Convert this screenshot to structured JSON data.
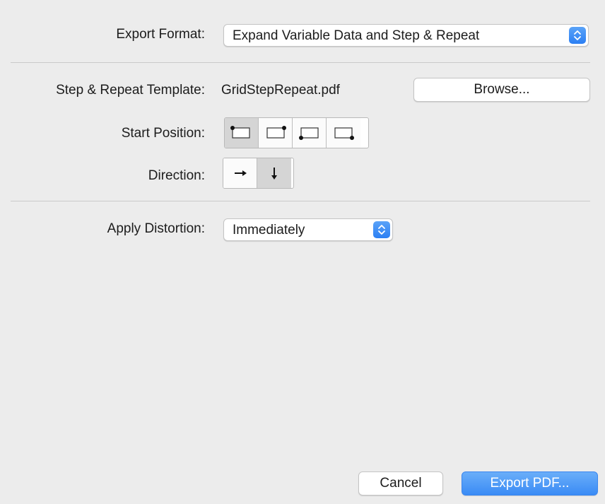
{
  "export_format": {
    "label": "Export Format:",
    "selected": "Expand Variable Data and Step & Repeat"
  },
  "template": {
    "label": "Step & Repeat Template:",
    "filename": "GridStepRepeat.pdf",
    "browse_label": "Browse..."
  },
  "start_position": {
    "label": "Start Position:",
    "options": [
      "top-left",
      "top-right",
      "bottom-left",
      "bottom-right"
    ],
    "selected": "top-left"
  },
  "direction": {
    "label": "Direction:",
    "options": [
      "horizontal",
      "vertical"
    ],
    "icons": [
      "arrow-right-icon",
      "arrow-down-icon"
    ],
    "selected": "vertical"
  },
  "distortion": {
    "label": "Apply Distortion:",
    "selected": "Immediately"
  },
  "footer": {
    "cancel_label": "Cancel",
    "export_label": "Export PDF..."
  },
  "colors": {
    "accent": "#3a8bf5",
    "background": "#ececec"
  }
}
